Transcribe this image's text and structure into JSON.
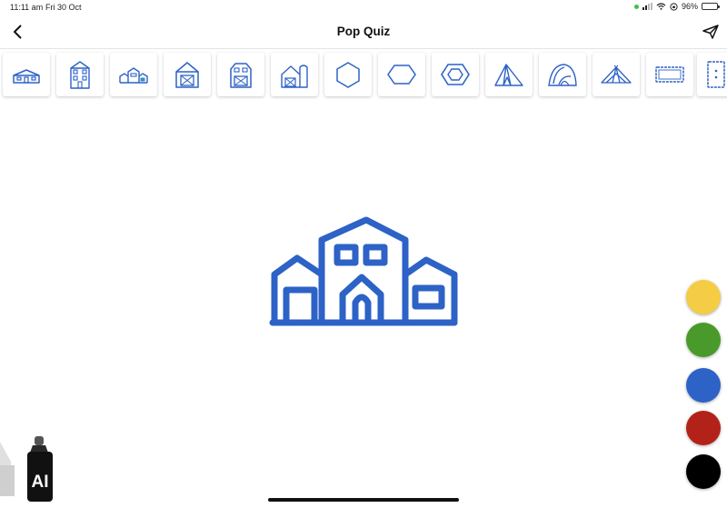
{
  "status_bar": {
    "time": "11:11 am",
    "date": "Fri 30 Oct",
    "battery": "96%",
    "battery_level": 0.96
  },
  "nav": {
    "title": "Pop Quiz"
  },
  "shape_strip": {
    "items": [
      "small-house",
      "townhouse",
      "row-houses",
      "barn",
      "barn-doors",
      "barn-silo",
      "hexagon-thin",
      "hexagon-wide",
      "hexagon-nested",
      "tent",
      "dome-tent",
      "wide-tent",
      "rug-rectangle",
      "rug-partial"
    ]
  },
  "canvas": {
    "drawing": "house-group",
    "stroke_color": "#2d62c6"
  },
  "palette": {
    "colors": [
      {
        "name": "yellow",
        "hex": "#f5cd45"
      },
      {
        "name": "green",
        "hex": "#4a9a2b"
      },
      {
        "name": "blue",
        "hex": "#2d62c6"
      },
      {
        "name": "red",
        "hex": "#b32218"
      },
      {
        "name": "black",
        "hex": "#000000"
      }
    ]
  },
  "tools": {
    "ai_marker_label": "AI"
  }
}
